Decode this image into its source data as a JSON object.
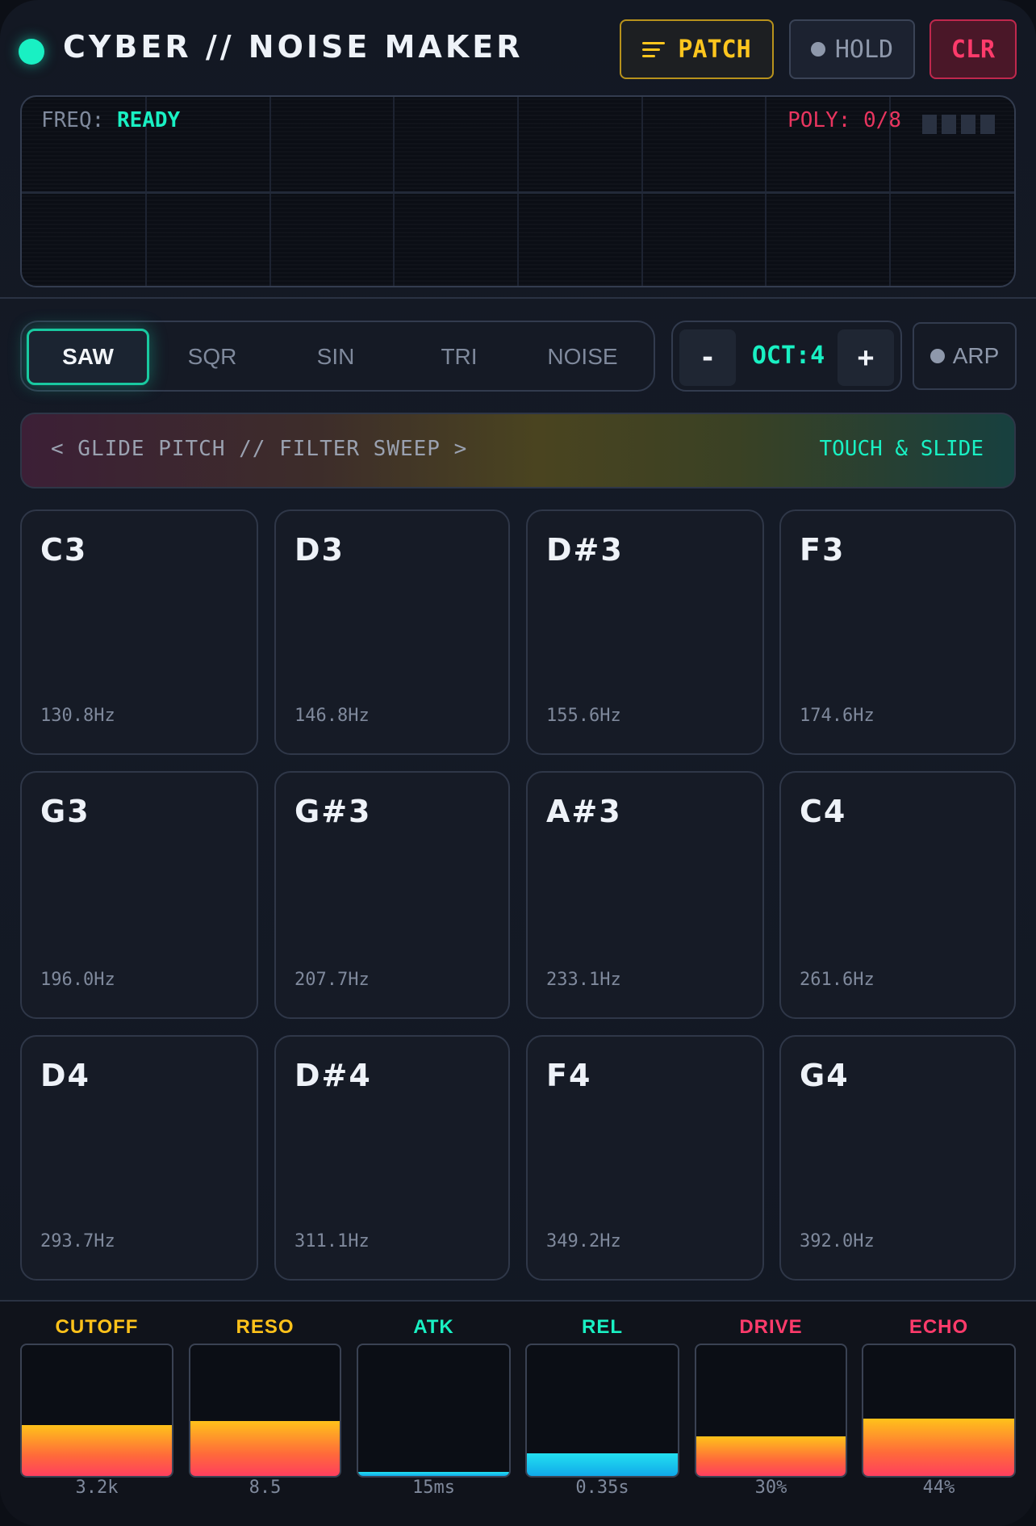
{
  "header": {
    "title": "CYBER // NOISE MAKER",
    "patch_label": "PATCH",
    "hold_label": "HOLD",
    "clear_label": "CLR"
  },
  "scope": {
    "freq_label": "FREQ:",
    "freq_status": "READY",
    "poly_label": "POLY: 0/8"
  },
  "waveforms": {
    "items": [
      "SAW",
      "SQR",
      "SIN",
      "TRI",
      "NOISE"
    ],
    "selected": "SAW"
  },
  "octave": {
    "minus": "-",
    "label": "OCT:4",
    "plus": "+"
  },
  "arp_label": "ARP",
  "glide": {
    "hint": "< GLIDE PITCH // FILTER SWEEP >",
    "action": "TOUCH & SLIDE"
  },
  "pads": [
    {
      "note": "C3",
      "freq": "130.8Hz"
    },
    {
      "note": "D3",
      "freq": "146.8Hz"
    },
    {
      "note": "D#3",
      "freq": "155.6Hz"
    },
    {
      "note": "F3",
      "freq": "174.6Hz"
    },
    {
      "note": "G3",
      "freq": "196.0Hz"
    },
    {
      "note": "G#3",
      "freq": "207.7Hz"
    },
    {
      "note": "A#3",
      "freq": "233.1Hz"
    },
    {
      "note": "C4",
      "freq": "261.6Hz"
    },
    {
      "note": "D4",
      "freq": "293.7Hz"
    },
    {
      "note": "D#4",
      "freq": "311.1Hz"
    },
    {
      "note": "F4",
      "freq": "349.2Hz"
    },
    {
      "note": "G4",
      "freq": "392.0Hz"
    }
  ],
  "controls": [
    {
      "label": "CUTOFF",
      "value": "3.2k",
      "level": 0.39,
      "color": "#ffc21a",
      "fill": "warm"
    },
    {
      "label": "RESO",
      "value": "8.5",
      "level": 0.42,
      "color": "#ffc21a",
      "fill": "warm"
    },
    {
      "label": "ATK",
      "value": "15ms",
      "level": 0.03,
      "color": "#19f0c3",
      "fill": "cool"
    },
    {
      "label": "REL",
      "value": "0.35s",
      "level": 0.17,
      "color": "#19f0c3",
      "fill": "cool"
    },
    {
      "label": "DRIVE",
      "value": "30%",
      "level": 0.3,
      "color": "#ff3b6b",
      "fill": "warm"
    },
    {
      "label": "ECHO",
      "value": "44%",
      "level": 0.44,
      "color": "#ff3b6b",
      "fill": "warm"
    }
  ],
  "colors": {
    "accent": "#19f0c3",
    "patch": "#ffc61e",
    "clear": "#ff3b6b",
    "background": "#131823"
  },
  "icons": {
    "status": "status-led-icon",
    "patch": "menu-icon",
    "hold": "dot-icon",
    "arp": "dot-icon"
  }
}
